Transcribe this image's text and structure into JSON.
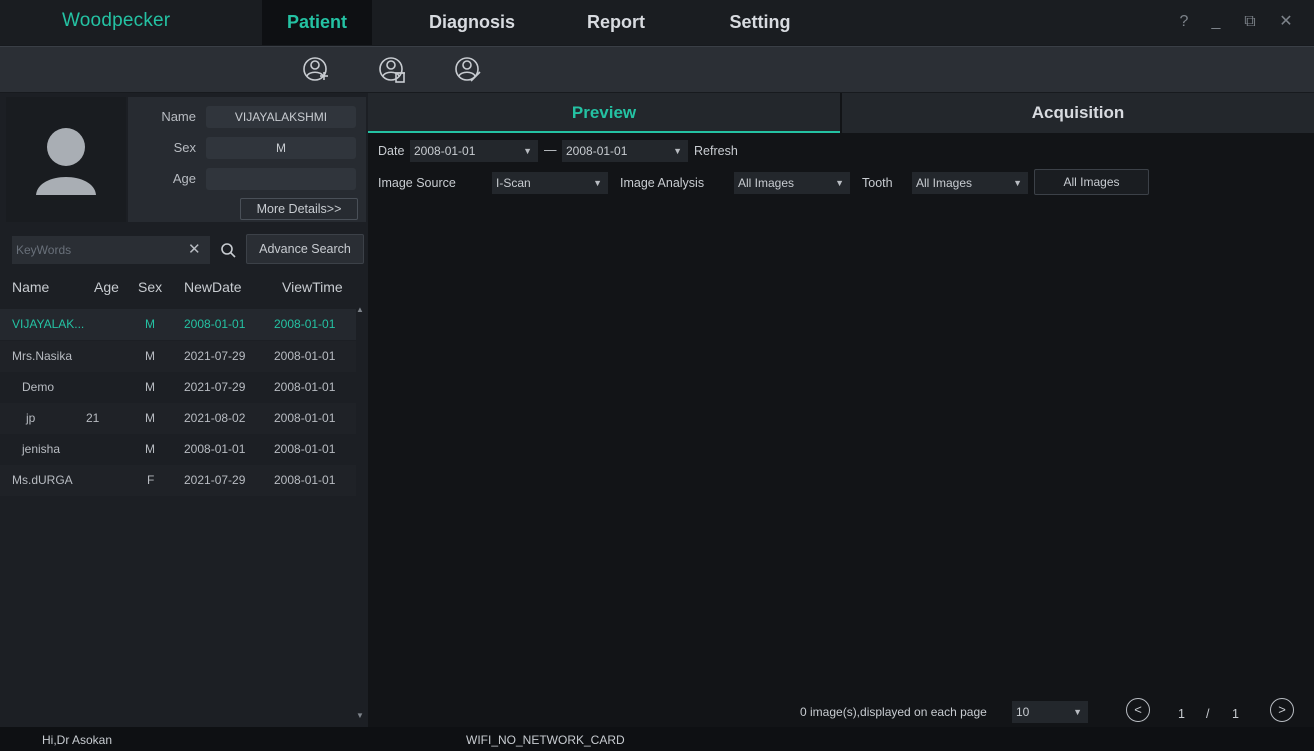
{
  "app": {
    "logo": "Woodpecker",
    "nav_tabs": [
      "Patient",
      "Diagnosis",
      "Report",
      "Setting"
    ],
    "window_controls": [
      "?",
      "_",
      "⧉",
      "✕"
    ],
    "accent_color": "#24c2a3"
  },
  "toolbar": {
    "icons": [
      "add-patient-icon",
      "delete-patient-icon",
      "edit-patient-icon"
    ]
  },
  "patient_info": {
    "name_label": "Name",
    "name_value": "VIJAYALAKSHMI",
    "sex_label": "Sex",
    "sex_value": "M",
    "age_label": "Age",
    "age_value": "",
    "more_details": "More Details>>"
  },
  "search": {
    "placeholder": "KeyWords",
    "clear": "✕",
    "advance_label": "Advance Search"
  },
  "patient_table": {
    "headers": [
      "Name",
      "Age",
      "Sex",
      "NewDate",
      "ViewTime"
    ],
    "rows": [
      {
        "name": "VIJAYALAK...",
        "age": "",
        "sex": "M",
        "newdate": "2008-01-01",
        "viewtime": "2008-01-01"
      },
      {
        "name": "Mrs.Nasika",
        "age": "",
        "sex": "M",
        "newdate": "2021-07-29",
        "viewtime": "2008-01-01"
      },
      {
        "name": "Demo",
        "age": "",
        "sex": "M",
        "newdate": "2021-07-29",
        "viewtime": "2008-01-01"
      },
      {
        "name": "jp",
        "age": "21",
        "sex": "M",
        "newdate": "2021-08-02",
        "viewtime": "2008-01-01"
      },
      {
        "name": "jenisha",
        "age": "",
        "sex": "M",
        "newdate": "2008-01-01",
        "viewtime": "2008-01-01"
      },
      {
        "name": "Ms.dURGA",
        "age": "",
        "sex": "F",
        "newdate": "2021-07-29",
        "viewtime": "2008-01-01"
      }
    ]
  },
  "preview": {
    "tabs": [
      "Preview",
      "Acquisition"
    ],
    "date_label": "Date",
    "date_from": "2008-01-01",
    "date_sep": "—",
    "date_to": "2008-01-01",
    "refresh": "Refresh",
    "image_source_label": "Image Source",
    "image_source_value": "I-Scan",
    "image_analysis_label": "Image Analysis",
    "image_analysis_value": "All Images",
    "tooth_label": "Tooth",
    "tooth_value": "All Images",
    "all_images_button": "All Images"
  },
  "pagination": {
    "info": "0 image(s),displayed on each page",
    "per_page": "10",
    "current": "1",
    "sep": "/",
    "total": "1"
  },
  "statusbar": {
    "greeting": "Hi,Dr Asokan",
    "network": "WIFI_NO_NETWORK_CARD"
  }
}
